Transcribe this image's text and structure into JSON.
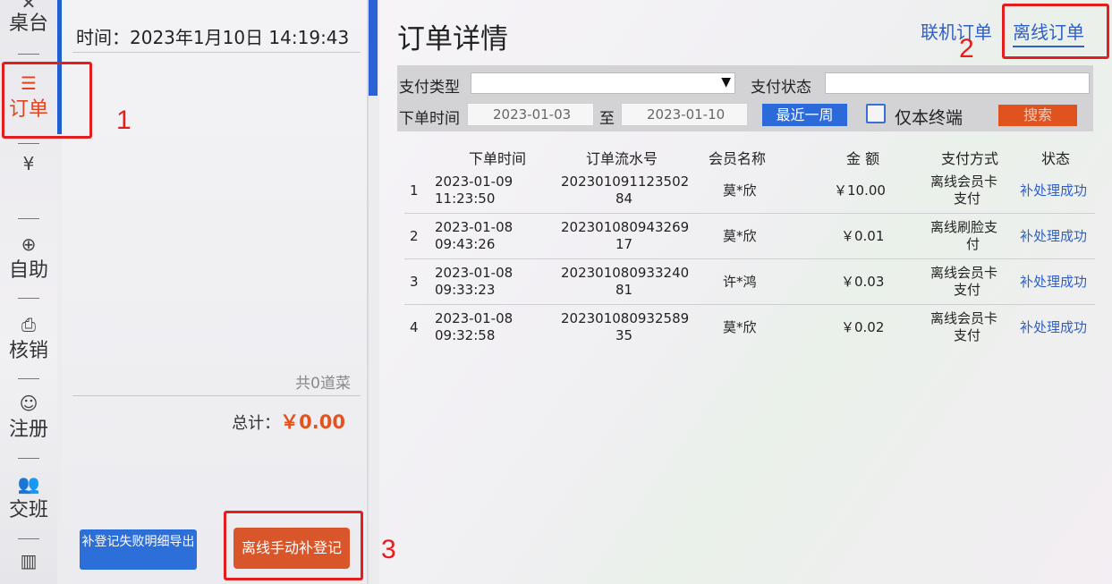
{
  "nav": {
    "items": [
      {
        "label": "桌台",
        "icon": "table-icon"
      },
      {
        "label": "订单",
        "icon": "list-icon"
      },
      {
        "label": "",
        "icon": "yen-icon"
      },
      {
        "label": "自助",
        "icon": "yen-circle-icon"
      },
      {
        "label": "核销",
        "icon": "printer-icon"
      },
      {
        "label": "注册",
        "icon": "smile-icon"
      },
      {
        "label": "交班",
        "icon": "people-icon"
      },
      {
        "label": "",
        "icon": "bar-chart-icon"
      }
    ],
    "accent": "#e0451f"
  },
  "cart": {
    "time": "时间：2023年1月10日 14:19:43",
    "count": "共0道菜",
    "total_label": "总计：",
    "total_amount": "￥0.00",
    "fail_export_label": "补登记失败明细导出",
    "manual_label": "离线手动补登记"
  },
  "main": {
    "title": "订单详情",
    "tabs": {
      "online": "联机订单",
      "offline": "离线订单"
    },
    "filters": {
      "pay_type_label": "支付类型",
      "pay_status_label": "支付状态",
      "order_time_label": "下单时间",
      "date_from": "2023-01-03",
      "to_label": "至",
      "date_to": "2023-01-10",
      "recent_week": "最近一周",
      "only_terminal": "仅本终端",
      "search": "搜索"
    },
    "table": {
      "headers": {
        "time": "下单时间",
        "serial": "订单流水号",
        "member": "会员名称",
        "amount": "金 额",
        "pay_method": "支付方式",
        "status": "状态"
      },
      "rows": [
        {
          "idx": "1",
          "date": "2023-01-09",
          "time": "11:23:50",
          "serial_a": "202301091123502",
          "serial_b": "84",
          "member": "莫*欣",
          "amount": "￥10.00",
          "pay_a": "离线会员卡",
          "pay_b": "支付",
          "status": "补处理成功"
        },
        {
          "idx": "2",
          "date": "2023-01-08",
          "time": "09:43:26",
          "serial_a": "202301080943269",
          "serial_b": "17",
          "member": "莫*欣",
          "amount": "￥0.01",
          "pay_a": "离线刷脸支",
          "pay_b": "付",
          "status": "补处理成功"
        },
        {
          "idx": "3",
          "date": "2023-01-08",
          "time": "09:33:23",
          "serial_a": "202301080933240",
          "serial_b": "81",
          "member": "许*鸿",
          "amount": "￥0.03",
          "pay_a": "离线会员卡",
          "pay_b": "支付",
          "status": "补处理成功"
        },
        {
          "idx": "4",
          "date": "2023-01-08",
          "time": "09:32:58",
          "serial_a": "202301080932589",
          "serial_b": "35",
          "member": "莫*欣",
          "amount": "￥0.02",
          "pay_a": "离线会员卡",
          "pay_b": "支付",
          "status": "补处理成功"
        }
      ]
    }
  },
  "annotations": [
    "1",
    "2",
    "3"
  ]
}
